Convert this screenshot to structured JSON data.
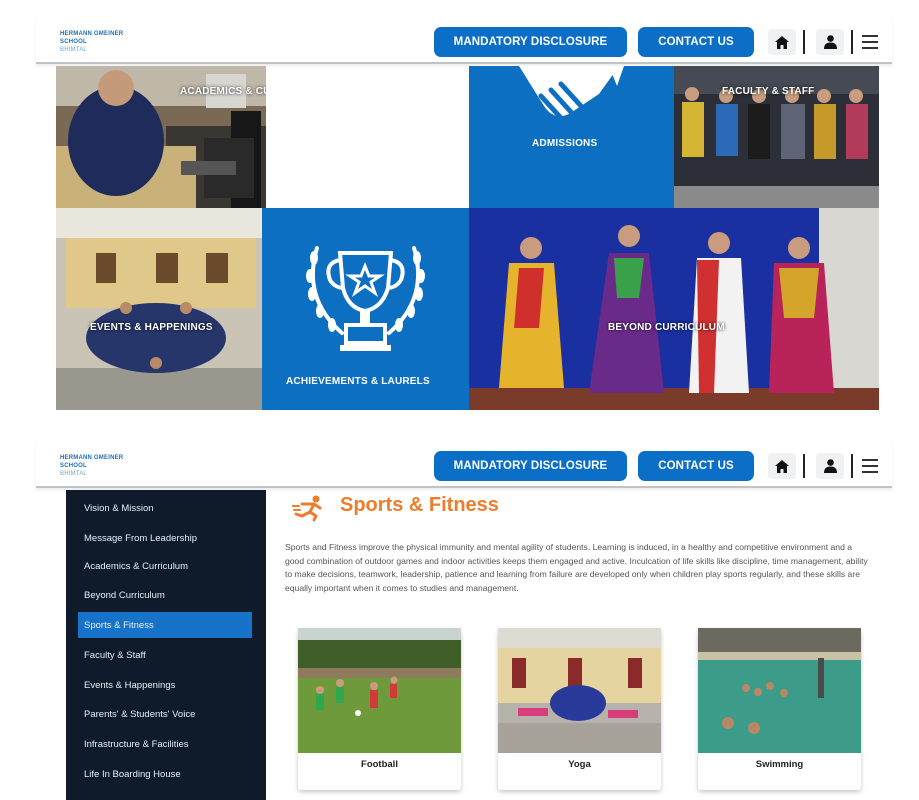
{
  "header": {
    "logo_line1": "HERMANN GMEINER",
    "logo_line2": "SCHOOL",
    "logo_line3": "BHIMTAL",
    "mandatory_label": "MANDATORY DISCLOSURE",
    "contact_label": "CONTACT US",
    "icons": [
      "home-icon",
      "user-icon",
      "menu-icon"
    ]
  },
  "tiles": {
    "academics": "ACADEMICS & CURRICULUM",
    "admissions": "ADMISSIONS",
    "faculty": "FACULTY & STAFF",
    "events": "EVENTS & HAPPENINGS",
    "achievements": "ACHIEVEMENTS & LAURELS",
    "beyond": "BEYOND CURRICULUM"
  },
  "sidebar": {
    "items": [
      {
        "label": "Vision & Mission"
      },
      {
        "label": "Message From Leadership"
      },
      {
        "label": "Academics & Curriculum"
      },
      {
        "label": "Beyond Curriculum"
      },
      {
        "label": "Sports & Fitness",
        "active": true
      },
      {
        "label": "Faculty & Staff"
      },
      {
        "label": "Events & Happenings"
      },
      {
        "label": "Parents' & Students' Voice"
      },
      {
        "label": "Infrastructure & Facilities"
      },
      {
        "label": "Life In Boarding House"
      }
    ]
  },
  "main": {
    "title": "Sports & Fitness",
    "description": "Sports and Fitness improve the physical immunity and mental agility of students. Learning is induced, in a healthy and competitive environment and a good combination of outdoor games and indoor activities keeps them engaged and active. Inculcation of life skills like discipline, time management, ability to make decisions, teamwork, leadership, patience and learning from failure are developed only when children play sports regularly, and these skills are equally important when it comes to studies and management.",
    "cards": [
      {
        "caption": "Football"
      },
      {
        "caption": "Yoga"
      },
      {
        "caption": "Swimming"
      }
    ]
  },
  "colors": {
    "brand_blue": "#0b6fc7",
    "accent_orange": "#ee7d2b",
    "sidebar_bg": "#0f1b2a",
    "sidebar_active": "#1673c9"
  }
}
